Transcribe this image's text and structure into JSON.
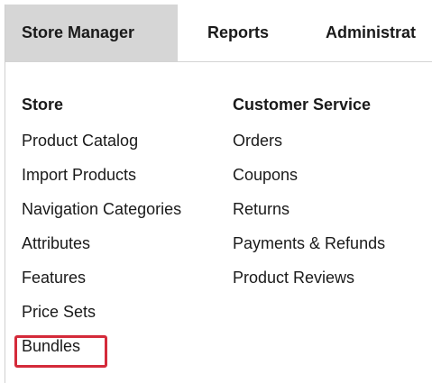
{
  "nav": {
    "tabs": [
      {
        "label": "Store Manager",
        "active": true
      },
      {
        "label": "Reports",
        "active": false
      },
      {
        "label": "Administrat",
        "active": false
      }
    ]
  },
  "menu": {
    "store": {
      "heading": "Store",
      "items": [
        "Product Catalog",
        "Import Products",
        "Navigation Categories",
        "Attributes",
        "Features",
        "Price Sets",
        "Bundles"
      ]
    },
    "customer_service": {
      "heading": "Customer Service",
      "items": [
        "Orders",
        "Coupons",
        "Returns",
        "Payments & Refunds",
        "Product Reviews"
      ]
    }
  },
  "colors": {
    "active_tab_bg": "#d6d6d6",
    "highlight_border": "#d42a3a"
  }
}
